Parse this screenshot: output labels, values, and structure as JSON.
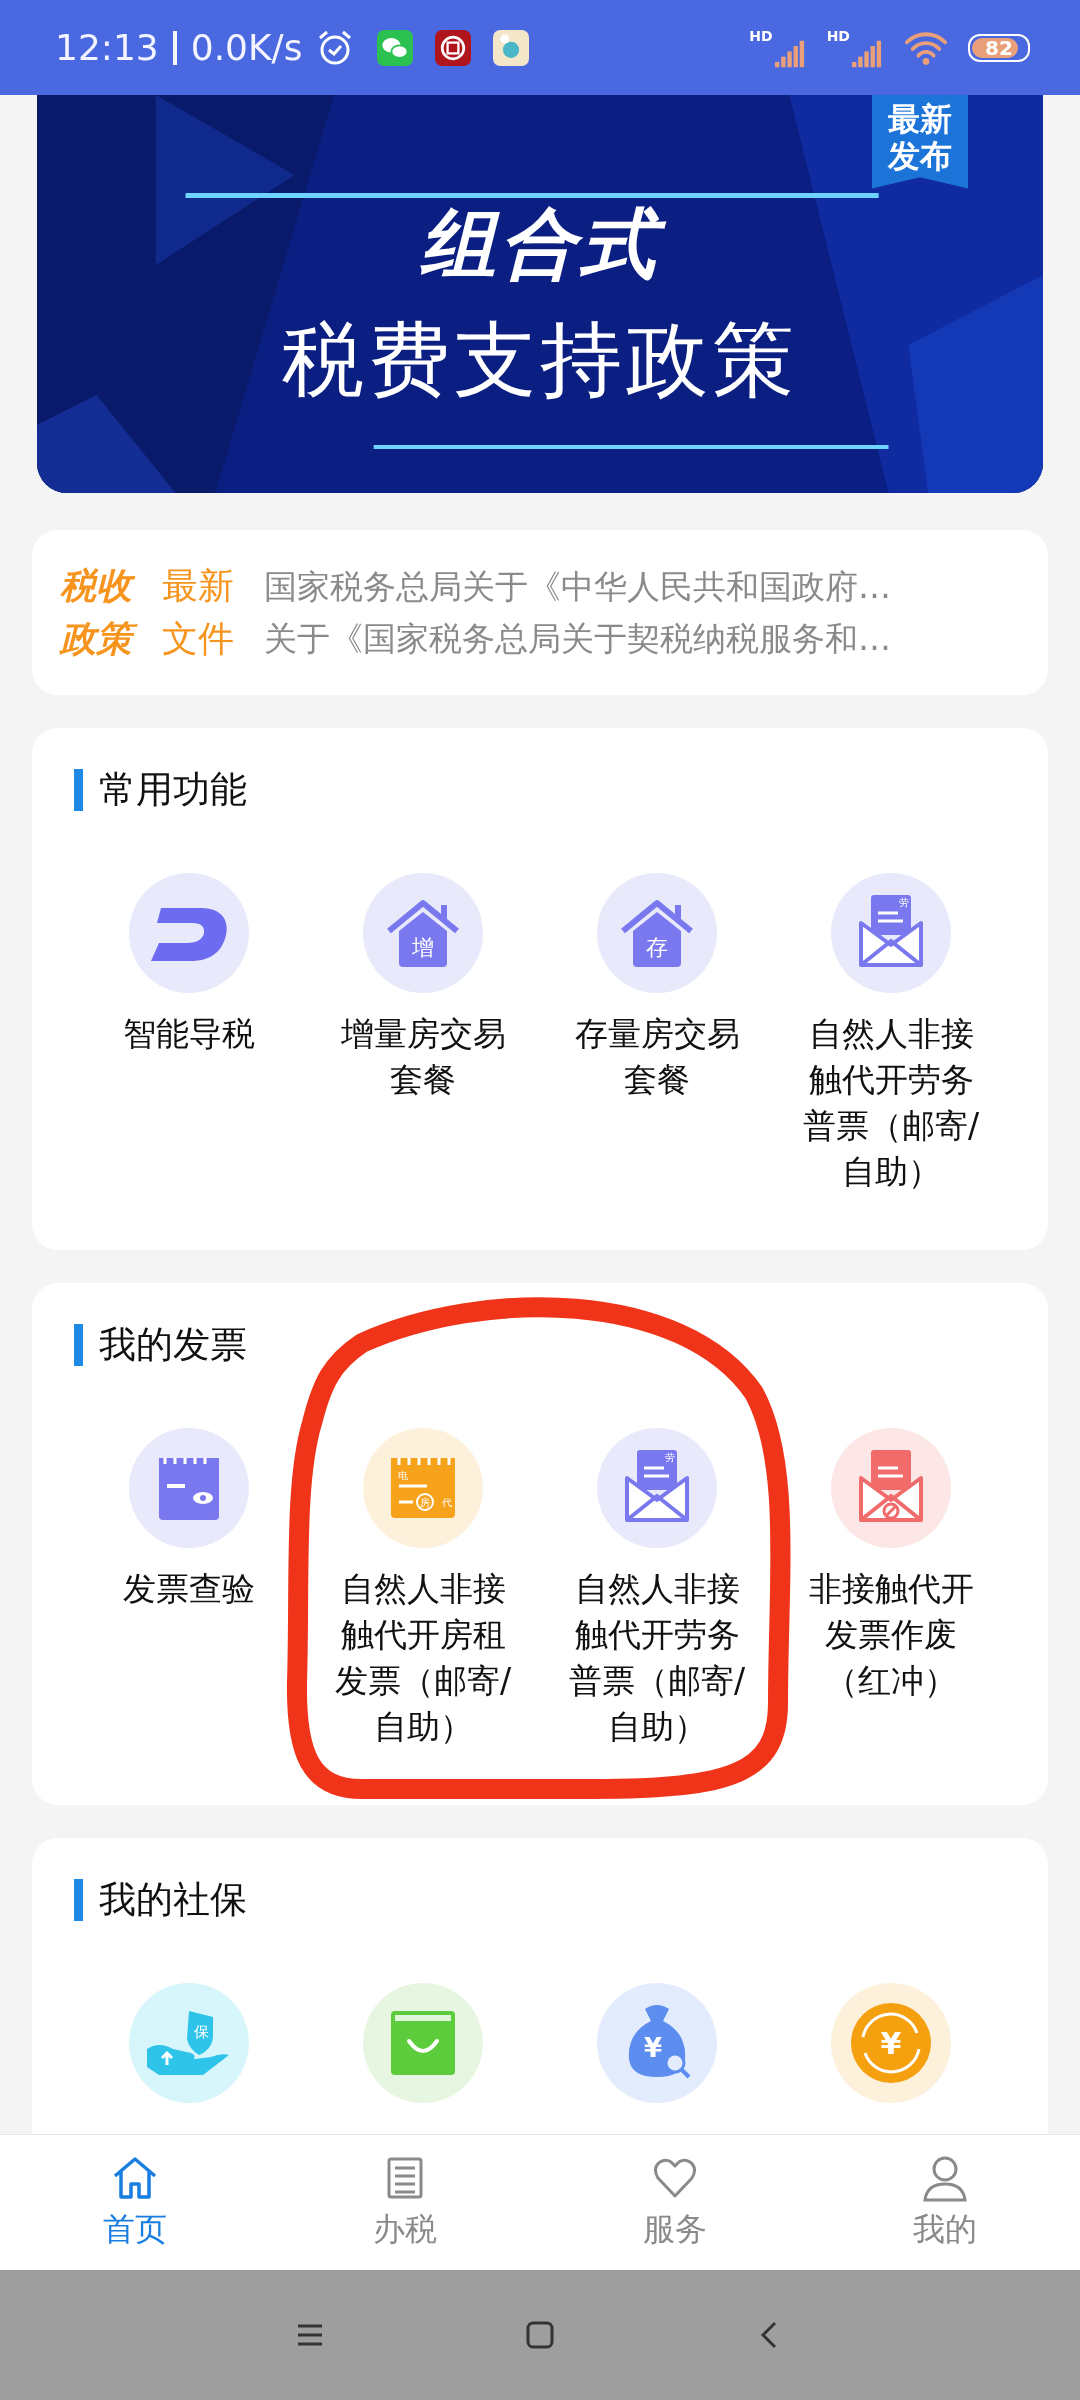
{
  "status_bar": {
    "time": "12:13",
    "speed": "0.0K/s",
    "signals": [
      "HD",
      "HD"
    ],
    "battery": "82"
  },
  "banner": {
    "title": "组合式",
    "subtitle": "税费支持政策",
    "badge": "最新发布"
  },
  "news": {
    "label": "税收政策",
    "tag": "最新文件",
    "items": [
      "国家税务总局关于《中华人民共和国政府…",
      "关于《国家税务总局关于契税纳税服务和…"
    ]
  },
  "sections": [
    {
      "title": "常用功能",
      "items": [
        {
          "kind": "d-logo",
          "label": "智能导税"
        },
        {
          "kind": "house",
          "glyph": [
            "增"
          ],
          "label": "增量房交易套餐"
        },
        {
          "kind": "house",
          "glyph": [
            "存"
          ],
          "label": "存量房交易套餐"
        },
        {
          "kind": "envelope",
          "glyph": [
            "劳"
          ],
          "label": "自然人非接触代开劳务普票（邮寄/自助）"
        }
      ]
    },
    {
      "title": "我的发票",
      "annotated": true,
      "items": [
        {
          "kind": "receipt-eye",
          "label": "发票查验"
        },
        {
          "kind": "receipt-house",
          "glyph": [
            "电",
            "房",
            "代"
          ],
          "label": "自然人非接触代开房租发票（邮寄/自助）"
        },
        {
          "kind": "envelope",
          "glyph": [
            "劳"
          ],
          "label": "自然人非接触代开劳务普票（邮寄/自助）"
        },
        {
          "kind": "envelope-void",
          "label": "非接触代开发票作废（红冲）"
        }
      ]
    },
    {
      "title": "我的社保",
      "items": [
        {
          "kind": "hand-shield",
          "glyph": [
            "保"
          ]
        },
        {
          "kind": "bag"
        },
        {
          "kind": "money-bag",
          "glyph": [
            "¥"
          ]
        },
        {
          "kind": "coin",
          "glyph": [
            "¥"
          ]
        }
      ]
    }
  ],
  "tabs": [
    {
      "label": "首页",
      "kind": "home",
      "selected": true
    },
    {
      "label": "办税",
      "kind": "list",
      "selected": false
    },
    {
      "label": "服务",
      "kind": "heart",
      "selected": false
    },
    {
      "label": "我的",
      "kind": "person",
      "selected": false
    }
  ]
}
